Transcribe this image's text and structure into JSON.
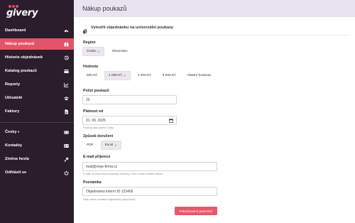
{
  "brand": {
    "logo_text": "givery"
  },
  "sidebar": {
    "items": [
      {
        "label": "Dashboard",
        "icon": "dashboard-gauge-icon",
        "active": false
      },
      {
        "label": "Nákup poukazů",
        "icon": "gift-icon",
        "active": true
      },
      {
        "label": "Historie objednávek",
        "icon": "history-icon",
        "active": false
      },
      {
        "label": "Katalog poukazů",
        "icon": "catalog-card-icon",
        "active": false
      },
      {
        "label": "Reporty",
        "icon": "chart-icon",
        "active": false
      },
      {
        "label": "Uživatelé",
        "icon": "users-icon",
        "active": false
      },
      {
        "label": "Faktury",
        "icon": "invoice-document-icon",
        "active": false
      },
      {
        "label": "Česky",
        "icon": "language-icon",
        "active": false,
        "dropdown": true
      },
      {
        "label": "Kontakty",
        "icon": "contact-card-icon",
        "active": false
      },
      {
        "label": "Změna hesla",
        "icon": "key-icon",
        "active": false
      },
      {
        "label": "Odhlásit se",
        "icon": "power-icon",
        "active": false
      }
    ]
  },
  "header": {
    "title": "Nákup poukazů"
  },
  "card": {
    "title": "Vytvořit objednávku na univerzální poukazy"
  },
  "form": {
    "region": {
      "label": "Region",
      "options": [
        "Česko",
        "Slovensko"
      ],
      "selected": "Česko"
    },
    "hodnota": {
      "label": "Hodnota",
      "options": [
        "500 Kč",
        "1 000 Kč",
        "2 000 Kč",
        "5 000 Kč",
        "Vlastní hodnota"
      ],
      "selected": "1 000 Kč"
    },
    "pocet": {
      "label": "Počet poukazů",
      "value": "20"
    },
    "platnost": {
      "label": "Platnost od",
      "value": "01. 09. 2025",
      "hint": "Poukazy jsou platné 3 roky."
    },
    "doruceni": {
      "label": "Způsob doručení",
      "options": [
        "PDF",
        "Excel"
      ],
      "selected": "Excel"
    },
    "email": {
      "label": "E-mail příjemce",
      "value": "mail@moje-firma.cz",
      "hint": "E-mail, na který budou poukazy odeslány. Více e-mailů oddělte čárkou."
    },
    "poznamka": {
      "label": "Poznámka",
      "value": "Objednávka interní ID 123456",
      "hint": "Vaše interní označení objednávky (nepovinné)"
    },
    "submit_label": "Pokračovat k potvrzení"
  },
  "colors": {
    "sidebar_bg": "#2c1d2c",
    "accent": "#e35468",
    "header_bg": "#e9e3f1"
  }
}
